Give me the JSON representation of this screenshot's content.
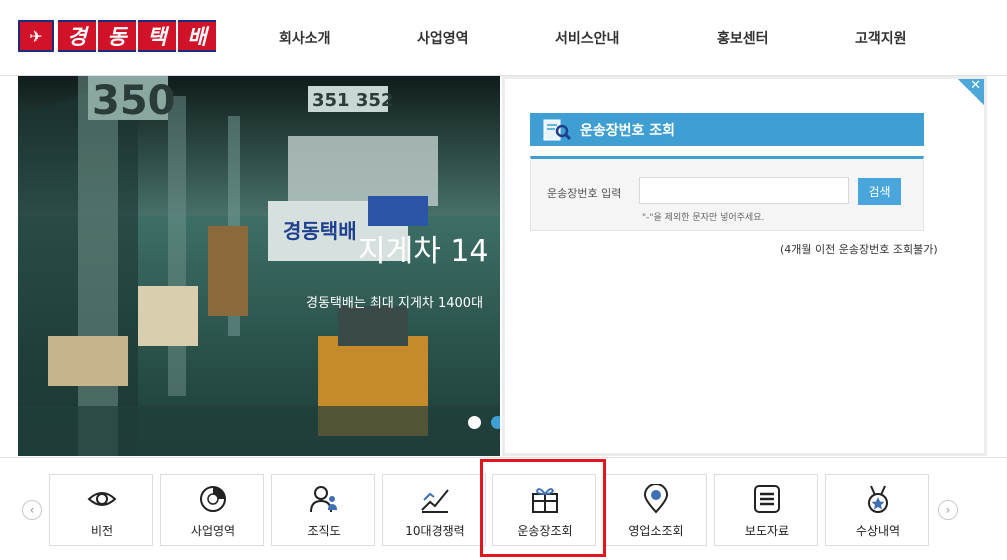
{
  "header": {
    "logo_text": "경동택배",
    "logo_syllables": [
      "경",
      "동",
      "택",
      "배"
    ],
    "nav": [
      "회사소개",
      "사업영역",
      "서비스안내",
      "홍보센터",
      "고객지원"
    ]
  },
  "hero": {
    "title": "지게차 14",
    "subtitle": "경동택배는 최대 지게차 1400대",
    "sign_text": "350",
    "sign_text2": "351 352",
    "truck_label": "경동택배",
    "colors": {
      "active_dot": "#ffffff",
      "next_dot": "#3f9fd3"
    }
  },
  "tracking": {
    "title": "운송장번호 조회",
    "input_label": "운송장번호 입력",
    "input_value": "",
    "search_label": "검색",
    "help_text": "\"-\"을 제외한 문자만 넣어주세요.",
    "note": "(4개월 이전 운송장번호 조회불가)",
    "accent_color": "#3f9fd3"
  },
  "quick_menu": {
    "items": [
      {
        "label": "비전",
        "icon": "eye-icon"
      },
      {
        "label": "사업영역",
        "icon": "pie-chart-icon"
      },
      {
        "label": "조직도",
        "icon": "people-icon"
      },
      {
        "label": "10대경쟁력",
        "icon": "trend-up-icon"
      },
      {
        "label": "운송장조회",
        "icon": "gift-box-icon"
      },
      {
        "label": "영업소조회",
        "icon": "location-pin-icon"
      },
      {
        "label": "보도자료",
        "icon": "news-icon"
      },
      {
        "label": "수상내역",
        "icon": "medal-icon"
      }
    ],
    "highlight_color": "#e3141b"
  }
}
